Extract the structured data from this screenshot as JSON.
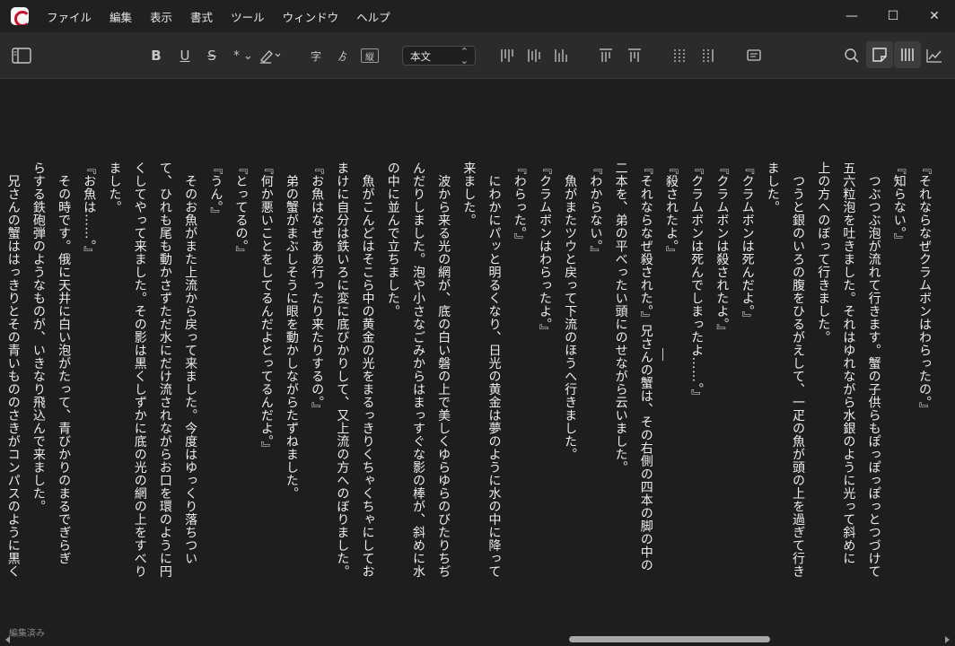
{
  "menu": [
    "ファイル",
    "編集",
    "表示",
    "書式",
    "ツール",
    "ウィンドウ",
    "ヘルプ"
  ],
  "window_controls": {
    "minimize": "—",
    "maximize": "☐",
    "close": "✕"
  },
  "toolbar": {
    "bold": "B",
    "underline": "U",
    "strike": "S",
    "emphasis": "* ⌄",
    "ruby": "字",
    "ruby_alt": "ゟ",
    "tcy": "縦",
    "style_value": "本文",
    "style_chevron": "⌃⌄"
  },
  "icons": [
    "sidebar-icon",
    "marker-icon",
    "search-icon",
    "memo-icon",
    "vertical-text-icon",
    "graph-icon"
  ],
  "editor": {
    "lines": [
      "『それならなぜクラムボンはわらったの。』",
      "『知らない。』",
      "　つぶつぶ泡が流れて行きます。蟹の子供らもぽっぽっぽっとつづけて",
      "五六粒泡を吐きました。それはゆれながら水銀のように光って斜めに",
      "上の方へのぼって行きました。",
      "　つうと銀のいろの腹をひるがえして、一疋の魚が頭の上を過ぎて行き",
      "ました。",
      "『クラムボンは死んだよ。』",
      "『クラムボンは殺されたよ。』",
      "『クラムボンは死んでしまったよ……。』",
      "『殺されたよ。』",
      "『それならなぜ殺された。』兄さんの蟹は、その右側の四本の脚の中の",
      "二本を、弟の平べったい頭にのせながら云いました。",
      "『わからない。』",
      "　魚がまたツウと戻って下流のほうへ行きました。",
      "『クラムボンはわらったよ。』",
      "『わらった。』",
      "　にわかにパッと明るくなり、日光の黄金は夢のように水の中に降って",
      "来ました。",
      "　波から来る光の網が、底の白い磐の上で美しくゆらゆらのびたりちぢ",
      "んだりしました。泡や小さなごみからはまっすぐな影の棒が、斜めに水",
      "の中に並んで立ちました。",
      "　魚がこんどはそこら中の黄金の光をまるっきりくちゃくちゃにしてお",
      "まけに自分は鉄いろに変に底びかりして、又上流の方へのぼりました。",
      "『お魚はなぜああ行ったり来たりするの。』",
      "　弟の蟹がまぶしそうに眼を動かしながらたずねました。",
      "『何か悪いことをしてるんだよとってるんだよ。』",
      "『とってるの。』",
      "『うん。』",
      "　そのお魚がまた上流から戻って来ました。今度はゆっくり落ちつい",
      "て、ひれも尾も動かさずただ水にだけ流されながらお口を環のように円",
      "くしてやって来ました。その影は黒くしずかに底の光の網の上をすべり",
      "ました。",
      "『お魚は……。』",
      "　その時です。俄に天井に白い泡がたって、青びかりのまるでぎらぎ",
      "らする鉄砲弾のようなものが、いきなり飛込んで来ました。",
      "　兄さんの蟹ははっきりとその青いもののさきがコンパスのように黒く"
    ]
  },
  "status": {
    "text": "編集済み"
  }
}
